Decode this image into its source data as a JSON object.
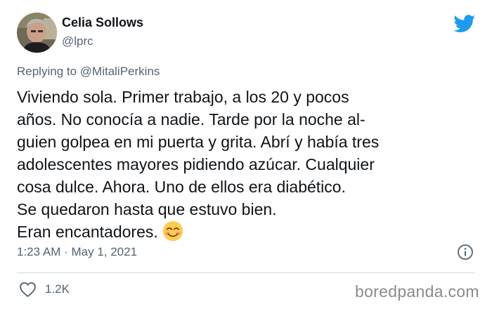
{
  "author": {
    "display_name": "Celia Sollows",
    "handle": "@lprc"
  },
  "reply": {
    "prefix": "Replying to ",
    "mention": "@MitaliPerkins"
  },
  "tweet": {
    "lines": [
      "Viviendo sola. Primer trabajo, a los 20 y pocos",
      "años. No conocía a nadie. Tarde por la noche al-",
      "guien golpea en mi puerta y grita. Abrí y había tres",
      "adolescentes mayores pidiendo azúcar. Cualquier",
      "cosa dulce. Ahora. Uno de ellos era diabético.",
      "Se quedaron hasta que estuvo bien.",
      "Eran encantadores."
    ],
    "emoji": "smiling-face-with-smiling-eyes"
  },
  "meta": {
    "timestamp": "1:23 AM · May 1, 2021"
  },
  "actions": {
    "like_count": "1.2K"
  },
  "watermark": "boredpanda.com",
  "icons": {
    "brand": "twitter-bird-icon",
    "info": "info-icon",
    "like": "heart-icon"
  },
  "colors": {
    "twitter_blue": "#1d9bf0",
    "text_primary": "#0f1419",
    "text_secondary": "#536471",
    "divider": "#cfd9de"
  }
}
